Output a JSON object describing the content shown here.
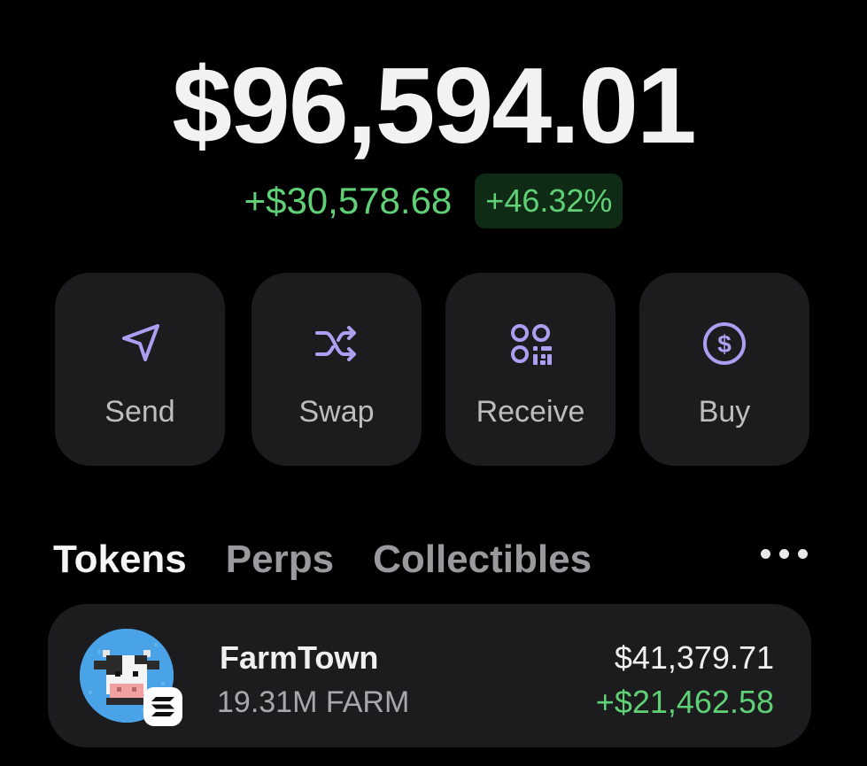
{
  "portfolio": {
    "balance": "$96,594.01",
    "change_amount": "+$30,578.68",
    "change_percent": "+46.32%"
  },
  "actions": [
    {
      "label": "Send",
      "icon": "send-arrow-icon"
    },
    {
      "label": "Swap",
      "icon": "shuffle-icon"
    },
    {
      "label": "Receive",
      "icon": "qr-code-icon"
    },
    {
      "label": "Buy",
      "icon": "dollar-circle-icon"
    }
  ],
  "tabs": [
    {
      "label": "Tokens",
      "active": true
    },
    {
      "label": "Perps",
      "active": false
    },
    {
      "label": "Collectibles",
      "active": false
    }
  ],
  "tokens": [
    {
      "name": "FarmTown",
      "amount": "19.31M FARM",
      "value": "$41,379.71",
      "change": "+$21,462.58",
      "icon": "cow-avatar-icon",
      "chain_icon": "solana-icon"
    }
  ],
  "colors": {
    "background": "#000000",
    "card": "#1c1c1e",
    "accent": "#ab9ff2",
    "positive": "#5fd075",
    "positive_bg": "#0f2a15"
  }
}
